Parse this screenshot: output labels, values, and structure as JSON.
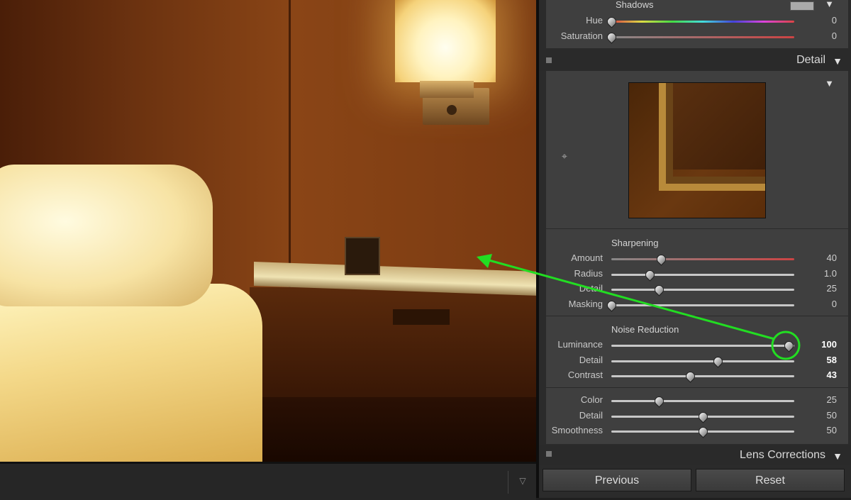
{
  "panel": {
    "color_section": {
      "group_title": "Shadows",
      "sliders": [
        {
          "label": "Hue",
          "value": "0",
          "fraction": 0.0
        },
        {
          "label": "Saturation",
          "value": "0",
          "fraction": 0.0
        }
      ]
    },
    "detail_header": {
      "title": "Detail",
      "arrow": "▼"
    },
    "detail": {
      "collapse_arrow": "▼",
      "sharpening": {
        "title": "Sharpening",
        "sliders": [
          {
            "label": "Amount",
            "value": "40",
            "fraction": 0.27
          },
          {
            "label": "Radius",
            "value": "1.0",
            "fraction": 0.21
          },
          {
            "label": "Detail",
            "value": "25",
            "fraction": 0.26
          },
          {
            "label": "Masking",
            "value": "0",
            "fraction": 0.0
          }
        ]
      },
      "noise_reduction": {
        "title": "Noise Reduction",
        "sliders": [
          {
            "label": "Luminance",
            "value": "100",
            "fraction": 0.97
          },
          {
            "label": "Detail",
            "value": "58",
            "fraction": 0.58
          },
          {
            "label": "Contrast",
            "value": "43",
            "fraction": 0.43
          }
        ]
      },
      "color_nr": {
        "sliders": [
          {
            "label": "Color",
            "value": "25",
            "fraction": 0.26
          },
          {
            "label": "Detail",
            "value": "50",
            "fraction": 0.5
          },
          {
            "label": "Smoothness",
            "value": "50",
            "fraction": 0.5
          }
        ]
      }
    },
    "lens_header": {
      "title": "Lens Corrections",
      "arrow": "▼"
    },
    "buttons": {
      "previous": "Previous",
      "reset": "Reset"
    }
  },
  "toolbar": {
    "menu_glyph": "▽"
  },
  "icons": {
    "target": "target-icon",
    "collapse": "triangle-down-icon"
  },
  "colors": {
    "annotation": "#22dd22",
    "panel_bg": "#3f3f3f"
  }
}
